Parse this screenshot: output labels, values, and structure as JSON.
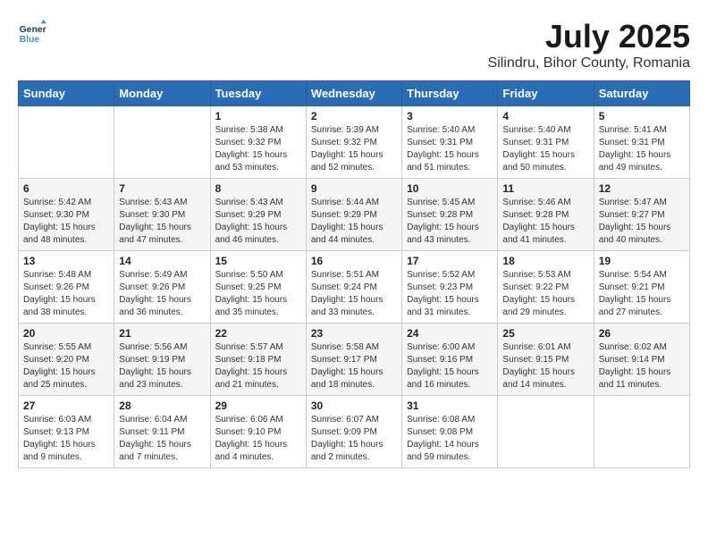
{
  "header": {
    "logo_line1": "General",
    "logo_line2": "Blue",
    "main_title": "July 2025",
    "subtitle": "Silindru, Bihor County, Romania"
  },
  "weekdays": [
    "Sunday",
    "Monday",
    "Tuesday",
    "Wednesday",
    "Thursday",
    "Friday",
    "Saturday"
  ],
  "weeks": [
    [
      {
        "day": "",
        "sunrise": "",
        "sunset": "",
        "daylight": ""
      },
      {
        "day": "",
        "sunrise": "",
        "sunset": "",
        "daylight": ""
      },
      {
        "day": "1",
        "sunrise": "Sunrise: 5:38 AM",
        "sunset": "Sunset: 9:32 PM",
        "daylight": "Daylight: 15 hours and 53 minutes."
      },
      {
        "day": "2",
        "sunrise": "Sunrise: 5:39 AM",
        "sunset": "Sunset: 9:32 PM",
        "daylight": "Daylight: 15 hours and 52 minutes."
      },
      {
        "day": "3",
        "sunrise": "Sunrise: 5:40 AM",
        "sunset": "Sunset: 9:31 PM",
        "daylight": "Daylight: 15 hours and 51 minutes."
      },
      {
        "day": "4",
        "sunrise": "Sunrise: 5:40 AM",
        "sunset": "Sunset: 9:31 PM",
        "daylight": "Daylight: 15 hours and 50 minutes."
      },
      {
        "day": "5",
        "sunrise": "Sunrise: 5:41 AM",
        "sunset": "Sunset: 9:31 PM",
        "daylight": "Daylight: 15 hours and 49 minutes."
      }
    ],
    [
      {
        "day": "6",
        "sunrise": "Sunrise: 5:42 AM",
        "sunset": "Sunset: 9:30 PM",
        "daylight": "Daylight: 15 hours and 48 minutes."
      },
      {
        "day": "7",
        "sunrise": "Sunrise: 5:43 AM",
        "sunset": "Sunset: 9:30 PM",
        "daylight": "Daylight: 15 hours and 47 minutes."
      },
      {
        "day": "8",
        "sunrise": "Sunrise: 5:43 AM",
        "sunset": "Sunset: 9:29 PM",
        "daylight": "Daylight: 15 hours and 46 minutes."
      },
      {
        "day": "9",
        "sunrise": "Sunrise: 5:44 AM",
        "sunset": "Sunset: 9:29 PM",
        "daylight": "Daylight: 15 hours and 44 minutes."
      },
      {
        "day": "10",
        "sunrise": "Sunrise: 5:45 AM",
        "sunset": "Sunset: 9:28 PM",
        "daylight": "Daylight: 15 hours and 43 minutes."
      },
      {
        "day": "11",
        "sunrise": "Sunrise: 5:46 AM",
        "sunset": "Sunset: 9:28 PM",
        "daylight": "Daylight: 15 hours and 41 minutes."
      },
      {
        "day": "12",
        "sunrise": "Sunrise: 5:47 AM",
        "sunset": "Sunset: 9:27 PM",
        "daylight": "Daylight: 15 hours and 40 minutes."
      }
    ],
    [
      {
        "day": "13",
        "sunrise": "Sunrise: 5:48 AM",
        "sunset": "Sunset: 9:26 PM",
        "daylight": "Daylight: 15 hours and 38 minutes."
      },
      {
        "day": "14",
        "sunrise": "Sunrise: 5:49 AM",
        "sunset": "Sunset: 9:26 PM",
        "daylight": "Daylight: 15 hours and 36 minutes."
      },
      {
        "day": "15",
        "sunrise": "Sunrise: 5:50 AM",
        "sunset": "Sunset: 9:25 PM",
        "daylight": "Daylight: 15 hours and 35 minutes."
      },
      {
        "day": "16",
        "sunrise": "Sunrise: 5:51 AM",
        "sunset": "Sunset: 9:24 PM",
        "daylight": "Daylight: 15 hours and 33 minutes."
      },
      {
        "day": "17",
        "sunrise": "Sunrise: 5:52 AM",
        "sunset": "Sunset: 9:23 PM",
        "daylight": "Daylight: 15 hours and 31 minutes."
      },
      {
        "day": "18",
        "sunrise": "Sunrise: 5:53 AM",
        "sunset": "Sunset: 9:22 PM",
        "daylight": "Daylight: 15 hours and 29 minutes."
      },
      {
        "day": "19",
        "sunrise": "Sunrise: 5:54 AM",
        "sunset": "Sunset: 9:21 PM",
        "daylight": "Daylight: 15 hours and 27 minutes."
      }
    ],
    [
      {
        "day": "20",
        "sunrise": "Sunrise: 5:55 AM",
        "sunset": "Sunset: 9:20 PM",
        "daylight": "Daylight: 15 hours and 25 minutes."
      },
      {
        "day": "21",
        "sunrise": "Sunrise: 5:56 AM",
        "sunset": "Sunset: 9:19 PM",
        "daylight": "Daylight: 15 hours and 23 minutes."
      },
      {
        "day": "22",
        "sunrise": "Sunrise: 5:57 AM",
        "sunset": "Sunset: 9:18 PM",
        "daylight": "Daylight: 15 hours and 21 minutes."
      },
      {
        "day": "23",
        "sunrise": "Sunrise: 5:58 AM",
        "sunset": "Sunset: 9:17 PM",
        "daylight": "Daylight: 15 hours and 18 minutes."
      },
      {
        "day": "24",
        "sunrise": "Sunrise: 6:00 AM",
        "sunset": "Sunset: 9:16 PM",
        "daylight": "Daylight: 15 hours and 16 minutes."
      },
      {
        "day": "25",
        "sunrise": "Sunrise: 6:01 AM",
        "sunset": "Sunset: 9:15 PM",
        "daylight": "Daylight: 15 hours and 14 minutes."
      },
      {
        "day": "26",
        "sunrise": "Sunrise: 6:02 AM",
        "sunset": "Sunset: 9:14 PM",
        "daylight": "Daylight: 15 hours and 11 minutes."
      }
    ],
    [
      {
        "day": "27",
        "sunrise": "Sunrise: 6:03 AM",
        "sunset": "Sunset: 9:13 PM",
        "daylight": "Daylight: 15 hours and 9 minutes."
      },
      {
        "day": "28",
        "sunrise": "Sunrise: 6:04 AM",
        "sunset": "Sunset: 9:11 PM",
        "daylight": "Daylight: 15 hours and 7 minutes."
      },
      {
        "day": "29",
        "sunrise": "Sunrise: 6:06 AM",
        "sunset": "Sunset: 9:10 PM",
        "daylight": "Daylight: 15 hours and 4 minutes."
      },
      {
        "day": "30",
        "sunrise": "Sunrise: 6:07 AM",
        "sunset": "Sunset: 9:09 PM",
        "daylight": "Daylight: 15 hours and 2 minutes."
      },
      {
        "day": "31",
        "sunrise": "Sunrise: 6:08 AM",
        "sunset": "Sunset: 9:08 PM",
        "daylight": "Daylight: 14 hours and 59 minutes."
      },
      {
        "day": "",
        "sunrise": "",
        "sunset": "",
        "daylight": ""
      },
      {
        "day": "",
        "sunrise": "",
        "sunset": "",
        "daylight": ""
      }
    ]
  ]
}
